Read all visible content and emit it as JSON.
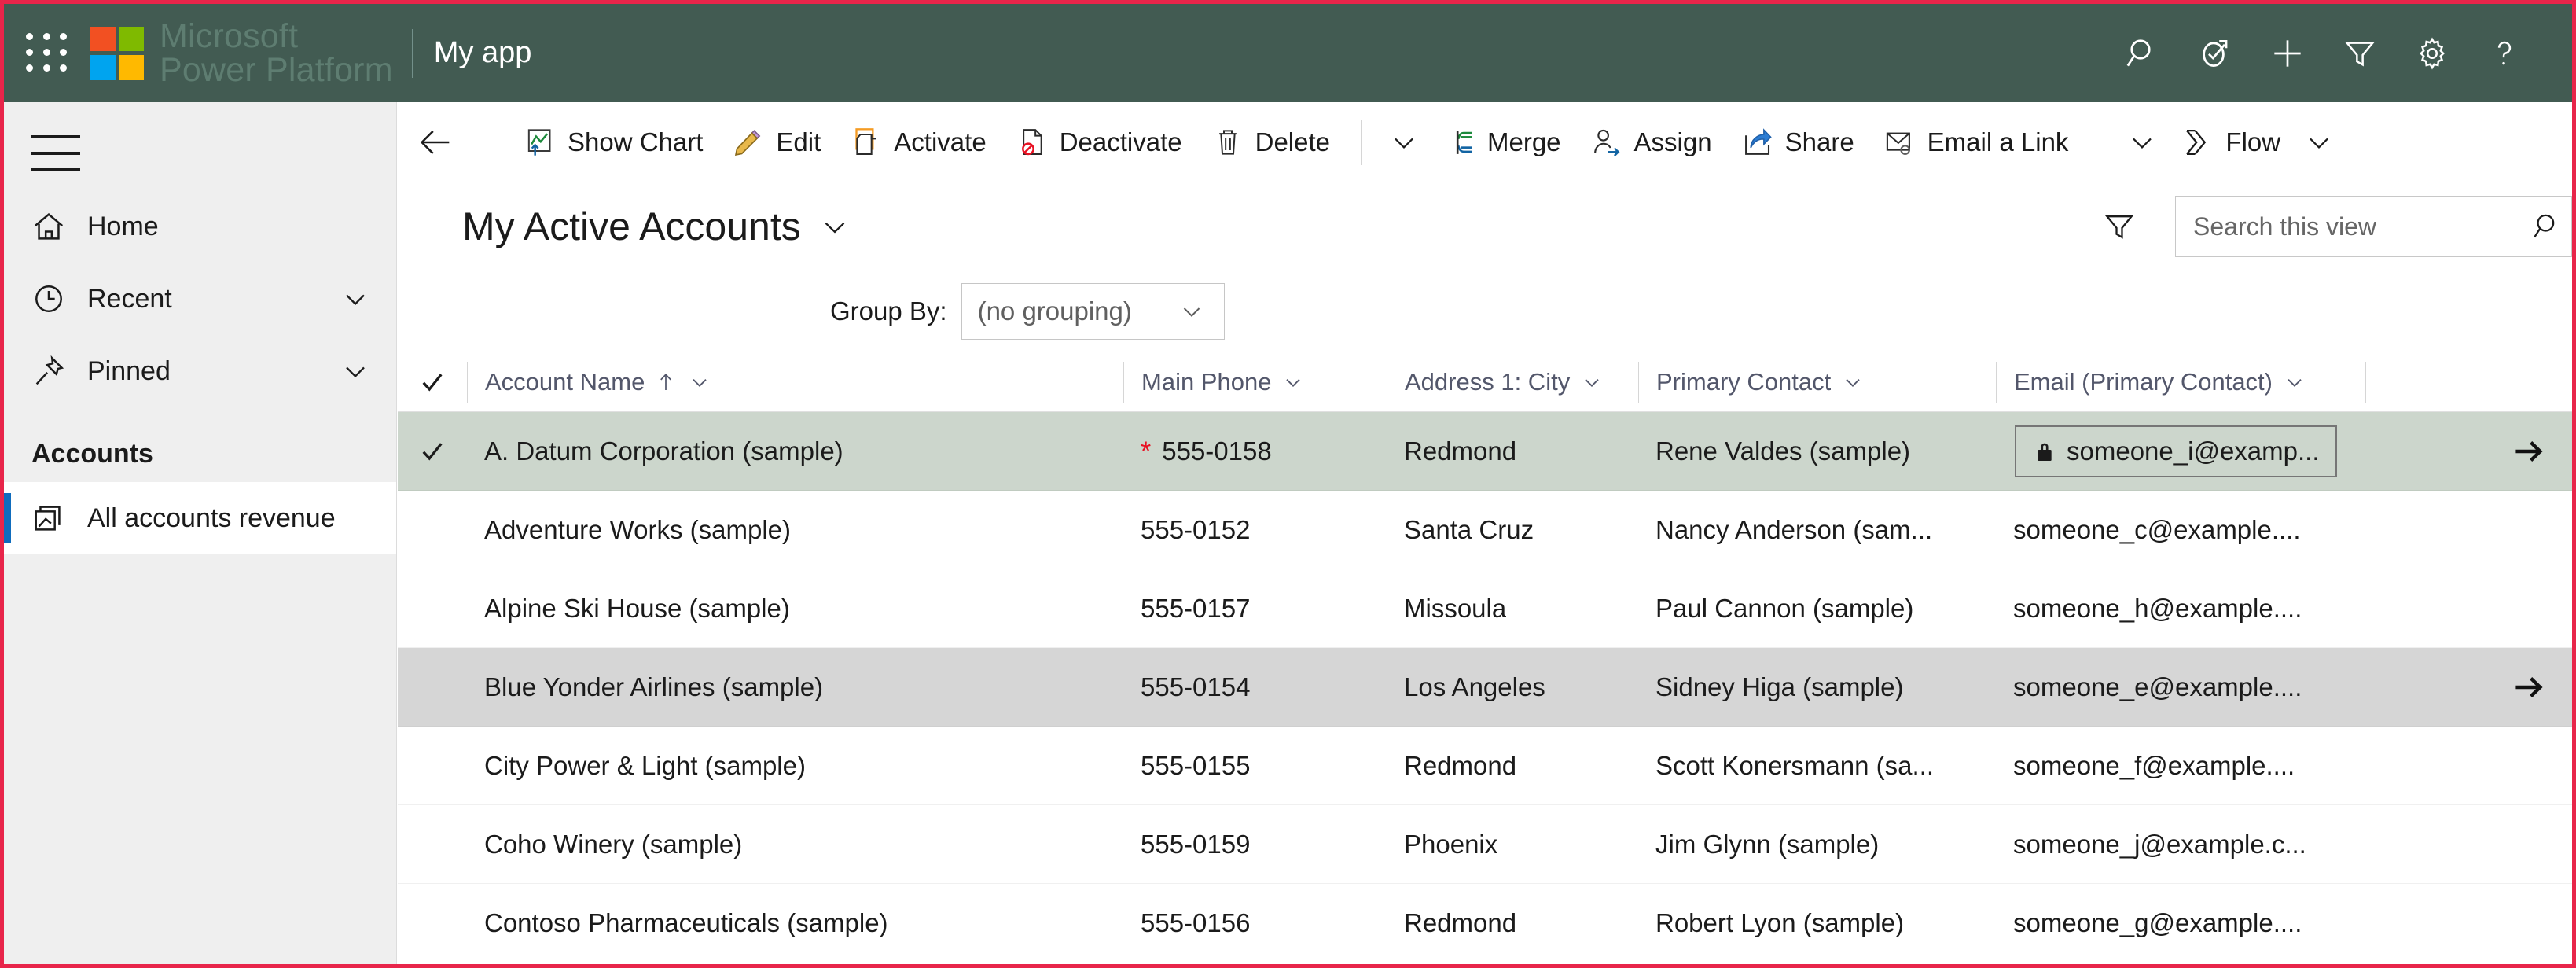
{
  "header": {
    "app_launcher": "waffle-icon",
    "brand_line1": "Microsoft",
    "brand_line2": "Power Platform",
    "app_title": "My app",
    "icons": [
      {
        "name": "search-icon",
        "label": "Search"
      },
      {
        "name": "assistant-icon",
        "label": "Assistant"
      },
      {
        "name": "plus-icon",
        "label": "New"
      },
      {
        "name": "filter-icon",
        "label": "Filter"
      },
      {
        "name": "gear-icon",
        "label": "Settings"
      },
      {
        "name": "help-icon",
        "label": "Help"
      }
    ],
    "colors": {
      "bar": "#425B52",
      "brand_text": "#5e7d71",
      "accent_border": "#e8254a"
    }
  },
  "sidebar": {
    "menu_toggle": "hamburger-icon",
    "items": [
      {
        "label": "Home",
        "icon": "home-icon",
        "expandable": false,
        "selected": false
      },
      {
        "label": "Recent",
        "icon": "clock-icon",
        "expandable": true,
        "selected": false
      },
      {
        "label": "Pinned",
        "icon": "pin-icon",
        "expandable": true,
        "selected": false
      }
    ],
    "section_title": "Accounts",
    "section_items": [
      {
        "label": "All accounts revenue",
        "icon": "dashboard-icon",
        "selected": true
      }
    ],
    "selection_color": "#0f6cbd"
  },
  "commandbar": {
    "back": "back-arrow-icon",
    "buttons": [
      {
        "label": "Show Chart",
        "icon": "chart-icon"
      },
      {
        "label": "Edit",
        "icon": "pencil-icon"
      },
      {
        "label": "Activate",
        "icon": "activate-icon"
      },
      {
        "label": "Deactivate",
        "icon": "deactivate-icon"
      },
      {
        "label": "Delete",
        "icon": "trash-icon"
      }
    ],
    "overflow_1": "chevron-down-icon",
    "buttons2": [
      {
        "label": "Merge",
        "icon": "merge-icon"
      },
      {
        "label": "Assign",
        "icon": "assign-icon"
      },
      {
        "label": "Share",
        "icon": "share-icon"
      },
      {
        "label": "Email a Link",
        "icon": "email-link-icon"
      }
    ],
    "overflow_2": "chevron-down-icon",
    "flow": {
      "label": "Flow",
      "icon": "flow-icon"
    },
    "flow_chevron": "chevron-down-icon"
  },
  "view": {
    "title": "My Active Accounts",
    "title_chevron": "chevron-down-icon",
    "filter_icon": "filter-icon",
    "search": {
      "placeholder": "Search this view",
      "value": "",
      "icon": "search-icon"
    }
  },
  "groupby": {
    "label": "Group By:",
    "value": "(no grouping)",
    "chevron": "chevron-down-icon"
  },
  "grid": {
    "select_all_icon": "checkmark-icon",
    "columns": [
      {
        "label": "Account Name",
        "sorted": "asc",
        "sort_icon": "arrow-up-icon",
        "chevron": "chevron-down-icon"
      },
      {
        "label": "Main Phone",
        "sorted": "",
        "chevron": "chevron-down-icon"
      },
      {
        "label": "Address 1: City",
        "sorted": "",
        "chevron": "chevron-down-icon"
      },
      {
        "label": "Primary Contact",
        "sorted": "",
        "chevron": "chevron-down-icon"
      },
      {
        "label": "Email (Primary Contact)",
        "sorted": "",
        "chevron": "chevron-down-icon"
      }
    ],
    "rows": [
      {
        "selected": true,
        "hovered": false,
        "check_icon": "checkmark-icon",
        "name": "A. Datum Corporation (sample)",
        "phone": "555-0158",
        "phone_required": true,
        "city": "Redmond",
        "contact": "Rene Valdes (sample)",
        "email": "someone_i@examp...",
        "email_locked": true,
        "email_focused": true,
        "row_arrow": "arrow-right-icon"
      },
      {
        "selected": false,
        "hovered": false,
        "name": "Adventure Works (sample)",
        "phone": "555-0152",
        "phone_required": false,
        "city": "Santa Cruz",
        "contact": "Nancy Anderson (sam...",
        "email": "someone_c@example....",
        "email_locked": false,
        "email_focused": false,
        "row_arrow": ""
      },
      {
        "selected": false,
        "hovered": false,
        "name": "Alpine Ski House (sample)",
        "phone": "555-0157",
        "phone_required": false,
        "city": "Missoula",
        "contact": "Paul Cannon (sample)",
        "email": "someone_h@example....",
        "email_locked": false,
        "email_focused": false,
        "row_arrow": ""
      },
      {
        "selected": false,
        "hovered": true,
        "name": "Blue Yonder Airlines (sample)",
        "phone": "555-0154",
        "phone_required": false,
        "city": "Los Angeles",
        "contact": "Sidney Higa (sample)",
        "email": "someone_e@example....",
        "email_locked": false,
        "email_focused": false,
        "row_arrow": "arrow-right-icon"
      },
      {
        "selected": false,
        "hovered": false,
        "name": "City Power & Light (sample)",
        "phone": "555-0155",
        "phone_required": false,
        "city": "Redmond",
        "contact": "Scott Konersmann (sa...",
        "email": "someone_f@example....",
        "email_locked": false,
        "email_focused": false,
        "row_arrow": ""
      },
      {
        "selected": false,
        "hovered": false,
        "name": "Coho Winery (sample)",
        "phone": "555-0159",
        "phone_required": false,
        "city": "Phoenix",
        "contact": "Jim Glynn (sample)",
        "email": "someone_j@example.c...",
        "email_locked": false,
        "email_focused": false,
        "row_arrow": ""
      },
      {
        "selected": false,
        "hovered": false,
        "name": "Contoso Pharmaceuticals (sample)",
        "phone": "555-0156",
        "phone_required": false,
        "city": "Redmond",
        "contact": "Robert Lyon (sample)",
        "email": "someone_g@example....",
        "email_locked": false,
        "email_focused": false,
        "row_arrow": ""
      }
    ]
  }
}
